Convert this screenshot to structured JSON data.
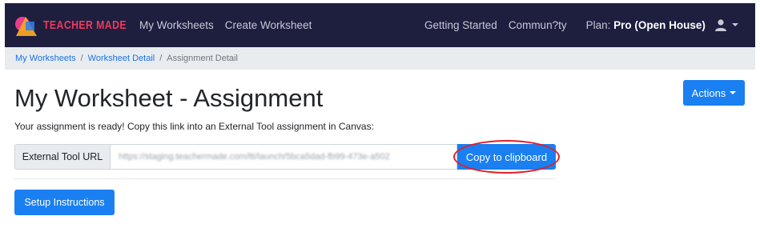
{
  "navbar": {
    "brand": "TEACHER MADE",
    "left_links": [
      "My Worksheets",
      "Create Worksheet"
    ],
    "right_links": [
      "Getting Started",
      "Commun?ty"
    ],
    "plan_label": "Plan:",
    "plan_value": "Pro (Open House)",
    "user_icon": "user-icon"
  },
  "breadcrumb": {
    "items": [
      "My Worksheets",
      "Worksheet Detail",
      "Assignment Detail"
    ],
    "separator": "/"
  },
  "page": {
    "title": "My Worksheet - Assignment",
    "description": "Your assignment is ready! Copy this link into an External Tool assignment in Canvas:",
    "actions_label": "Actions"
  },
  "external_tool": {
    "label": "External Tool URL",
    "value": "https://staging.teachermade.com/lti/launch/5bca5dad-fb99-473e-a502",
    "copy_label": "Copy to clipboard"
  },
  "setup_label": "Setup Instructions",
  "colors": {
    "navbar_bg": "#1e1e3f",
    "brand_red": "#ee3a5a",
    "primary_blue": "#1a7ff0",
    "highlight_ring": "#e2202a"
  }
}
